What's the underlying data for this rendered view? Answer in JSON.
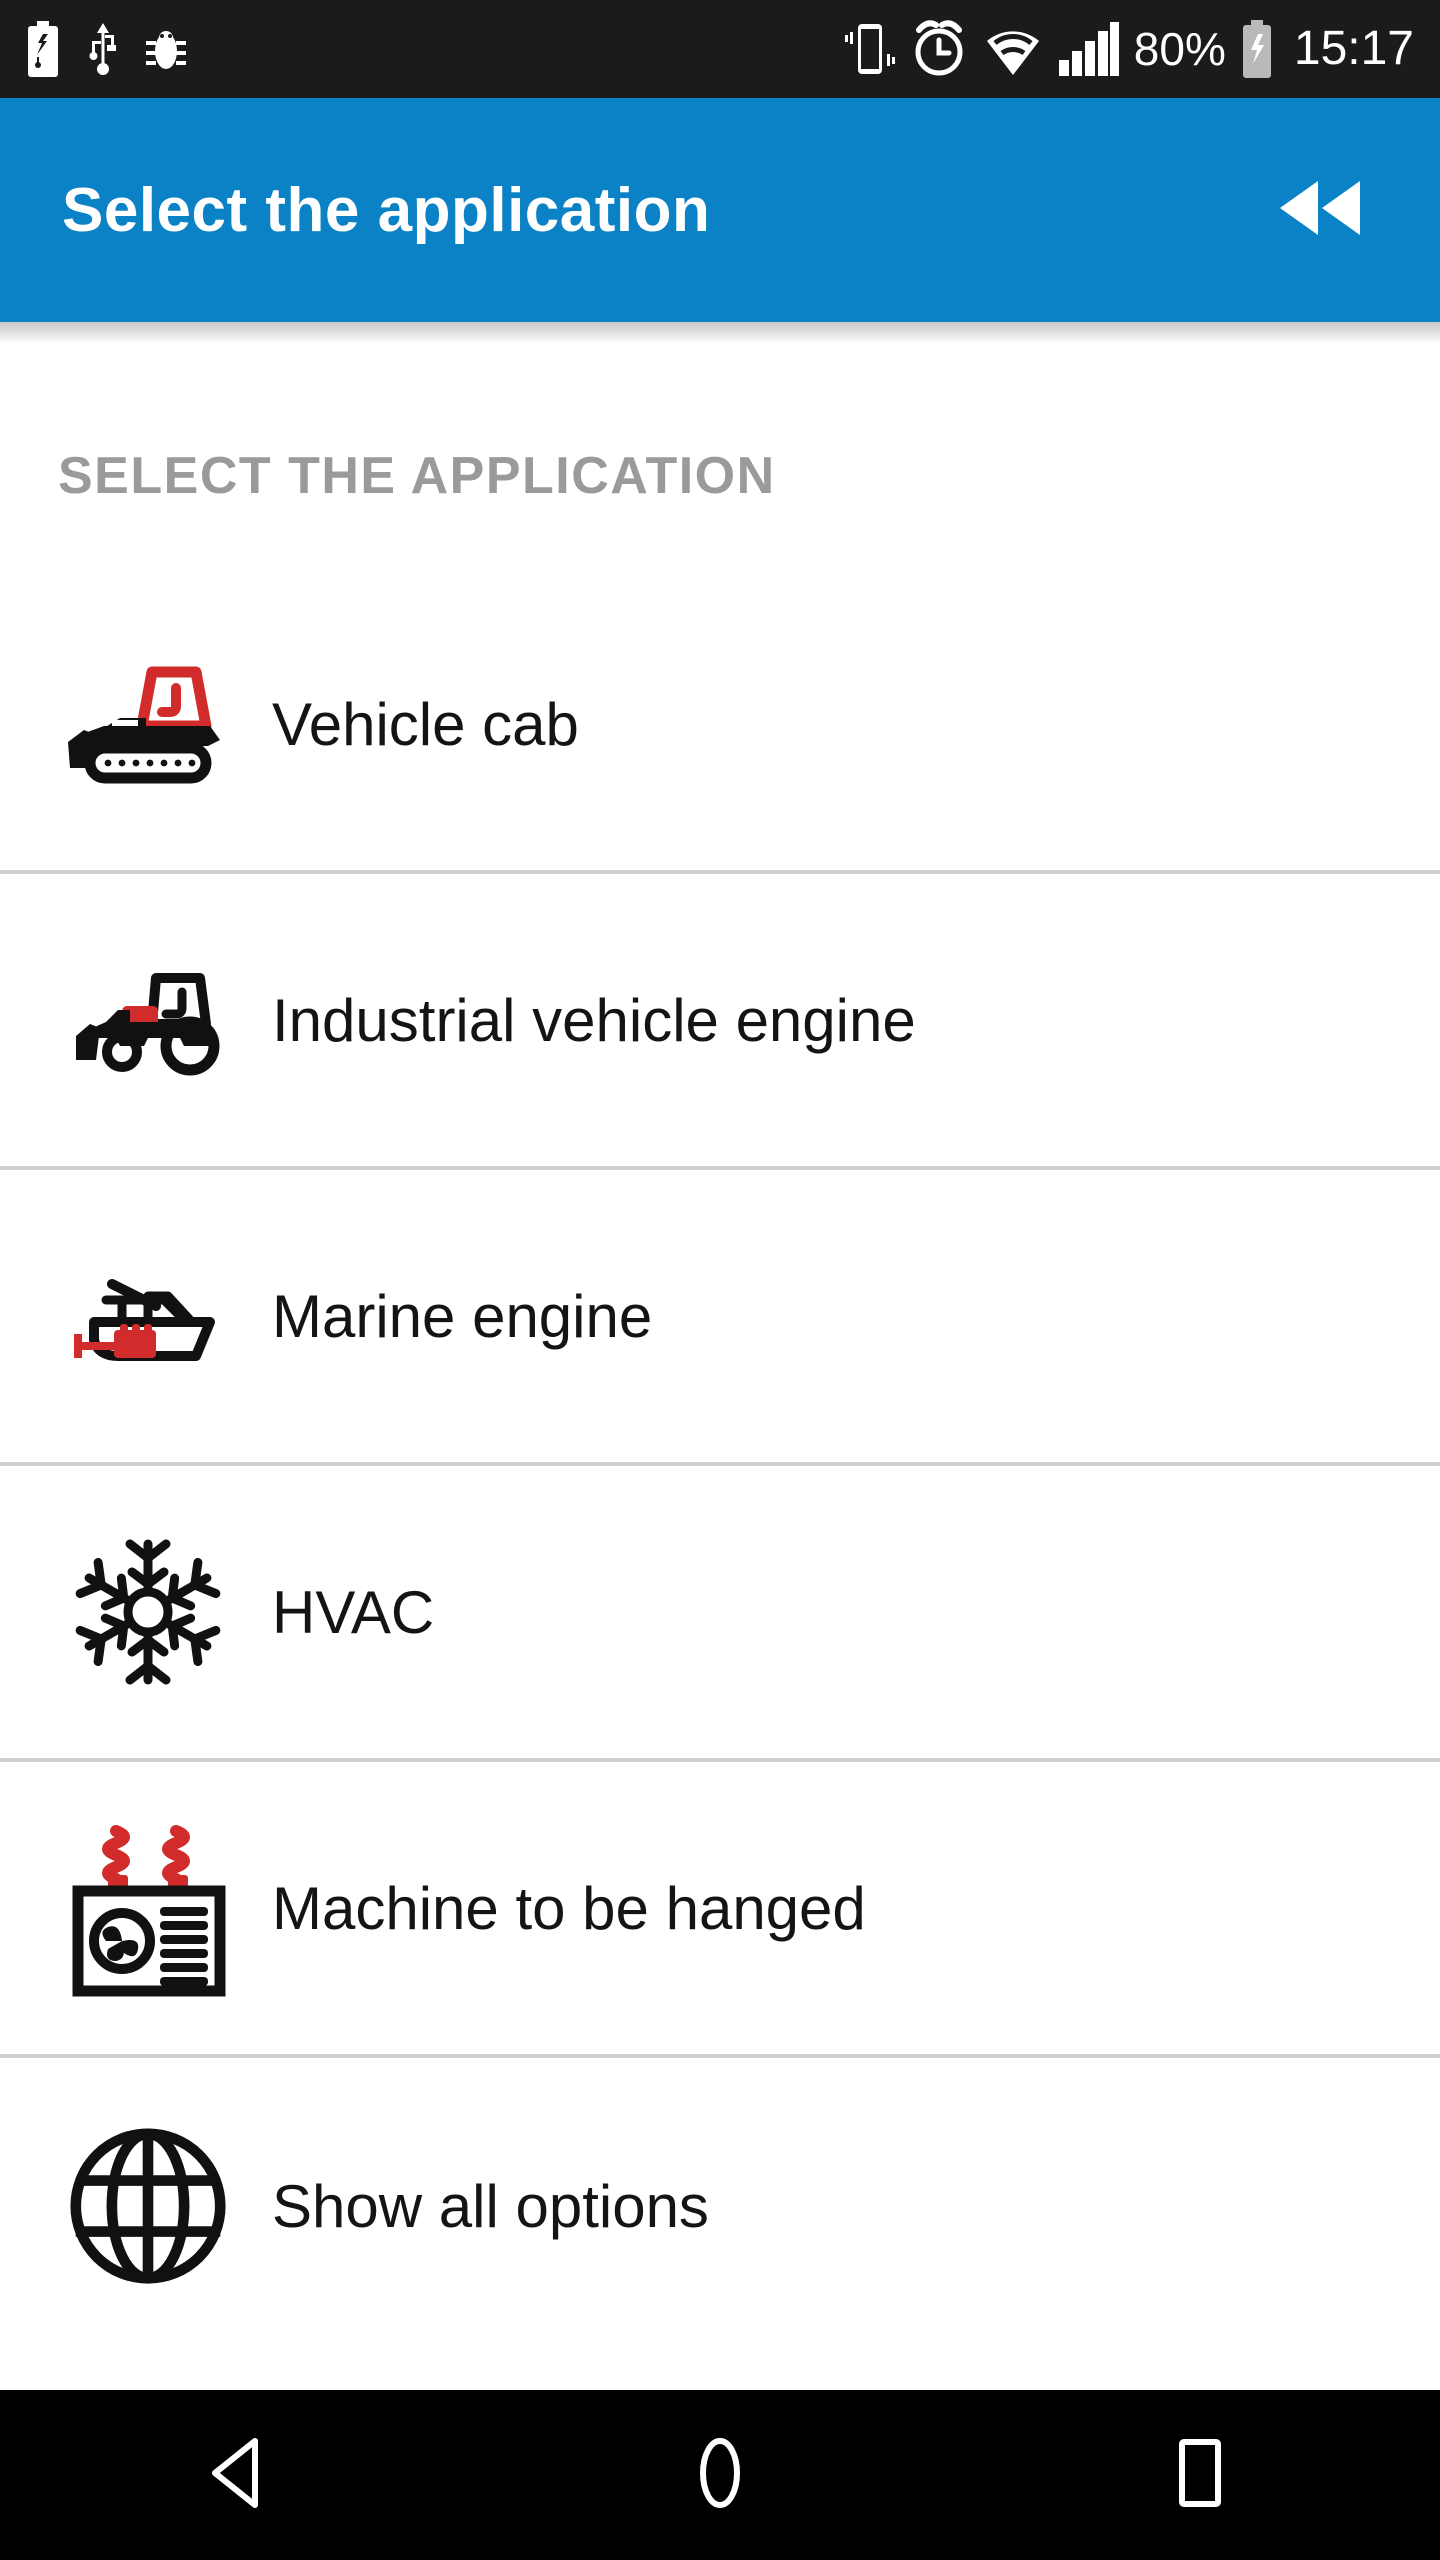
{
  "status_bar": {
    "left_icons": [
      {
        "name": "usb-battery-charging-icon",
        "label": "usb-battery-charging"
      },
      {
        "name": "usb-icon",
        "label": "usb"
      },
      {
        "name": "debug-bug-icon",
        "label": "debug-bug"
      }
    ],
    "right_icons": [
      {
        "name": "vibrate-icon",
        "label": "vibrate"
      },
      {
        "name": "alarm-clock-icon",
        "label": "alarm-clock"
      },
      {
        "name": "wifi-icon",
        "label": "wifi"
      },
      {
        "name": "cellular-signal-icon",
        "label": "cellular-signal"
      }
    ],
    "battery_percent": "80%",
    "battery_icon": "battery-charging-icon",
    "clock": "15:17"
  },
  "app_bar": {
    "title": "Select the application",
    "action_icon": "rewind-double-left-icon",
    "background_color": "#0b82c5",
    "text_color": "#ffffff"
  },
  "section": {
    "header": "SELECT THE APPLICATION",
    "header_color": "#9a9a9a"
  },
  "list": {
    "divider_color": "#d2d2d2",
    "accent_color": "#d22b2b",
    "items": [
      {
        "label": "Vehicle cab",
        "icon": "bulldozer-cab-icon"
      },
      {
        "label": "Industrial vehicle engine",
        "icon": "wheel-loader-engine-icon"
      },
      {
        "label": "Marine engine",
        "icon": "boat-engine-icon"
      },
      {
        "label": "HVAC",
        "icon": "snowflake-icon"
      },
      {
        "label": "Machine to be hanged",
        "icon": "hvac-unit-spring-icon"
      },
      {
        "label": "Show all options",
        "icon": "globe-icon"
      }
    ]
  },
  "nav_bar": {
    "back": "back-triangle-icon",
    "home": "home-circle-icon",
    "recents": "recents-square-icon"
  }
}
